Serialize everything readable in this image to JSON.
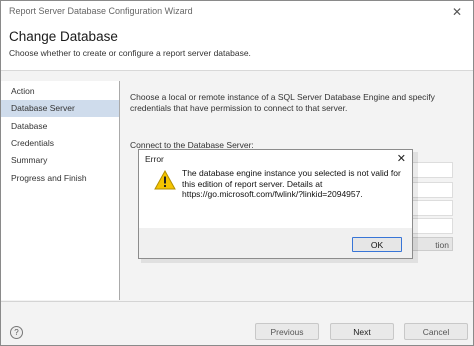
{
  "window": {
    "title": "Report Server Database Configuration Wizard",
    "close_glyph": "✕"
  },
  "header": {
    "title": "Change Database",
    "subtitle": "Choose whether to create or configure a report server database."
  },
  "sidebar": {
    "items": [
      {
        "label": "Action"
      },
      {
        "label": "Database Server",
        "selected": true
      },
      {
        "label": "Database"
      },
      {
        "label": "Credentials"
      },
      {
        "label": "Summary"
      },
      {
        "label": "Progress and Finish"
      }
    ]
  },
  "main": {
    "description": "Choose a local or remote instance of a SQL Server Database Engine and specify credentials that have permission to connect to that server.",
    "connect_label": "Connect to the Database Server:",
    "test_button_fragment": "tion"
  },
  "footer": {
    "help_glyph": "?",
    "previous_label": "Previous",
    "next_label": "Next",
    "cancel_label": "Cancel"
  },
  "dialog": {
    "title": "Error",
    "close_glyph": "✕",
    "message": "The database engine instance you selected is not valid for this edition of report server. Details at https://go.microsoft.com/fwlink/?linkid=2094957.",
    "ok_label": "OK",
    "icon": "warning-triangle-icon"
  },
  "colors": {
    "selected_nav": "#cfdcec",
    "warning_yellow": "#f5c400",
    "ok_focus_border": "#3875d7"
  }
}
